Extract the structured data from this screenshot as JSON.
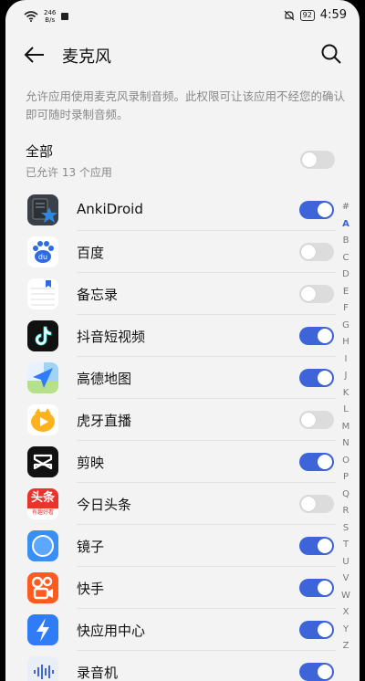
{
  "status": {
    "speed_top": "246",
    "speed_bottom": "B/s",
    "battery": "92",
    "time": "4:59"
  },
  "header": {
    "title": "麦克风"
  },
  "description": "允许应用使用麦克风录制音频。此权限可让该应用不经您的确认即可随时录制音频。",
  "all": {
    "label": "全部",
    "sublabel": "已允许 13 个应用",
    "enabled": false
  },
  "apps": [
    {
      "name": "AnkiDroid",
      "enabled": true,
      "icon": "ankidroid-icon"
    },
    {
      "name": "百度",
      "enabled": false,
      "icon": "baidu-icon"
    },
    {
      "name": "备忘录",
      "enabled": false,
      "icon": "notes-icon"
    },
    {
      "name": "抖音短视频",
      "enabled": true,
      "icon": "douyin-icon"
    },
    {
      "name": "高德地图",
      "enabled": true,
      "icon": "amap-icon"
    },
    {
      "name": "虎牙直播",
      "enabled": false,
      "icon": "huya-icon"
    },
    {
      "name": "剪映",
      "enabled": true,
      "icon": "capcut-icon"
    },
    {
      "name": "今日头条",
      "enabled": false,
      "icon": "toutiao-icon"
    },
    {
      "name": "镜子",
      "enabled": true,
      "icon": "mirror-icon"
    },
    {
      "name": "快手",
      "enabled": true,
      "icon": "kuaishou-icon"
    },
    {
      "name": "快应用中心",
      "enabled": true,
      "icon": "quickapp-icon"
    },
    {
      "name": "录音机",
      "enabled": true,
      "icon": "recorder-icon"
    }
  ],
  "icon_labels": {
    "toutiao_top": "头条",
    "toutiao_bottom": "有趣好看"
  },
  "alphabet": [
    "#",
    "A",
    "B",
    "C",
    "D",
    "E",
    "F",
    "G",
    "H",
    "I",
    "J",
    "K",
    "L",
    "M",
    "N",
    "O",
    "P",
    "Q",
    "R",
    "S",
    "T",
    "U",
    "V",
    "W",
    "X",
    "Y",
    "Z"
  ],
  "alphabet_active": "A",
  "colors": {
    "accent": "#3d64d9",
    "toggle_off": "#dcdcdc",
    "background": "#f3f3f3"
  }
}
